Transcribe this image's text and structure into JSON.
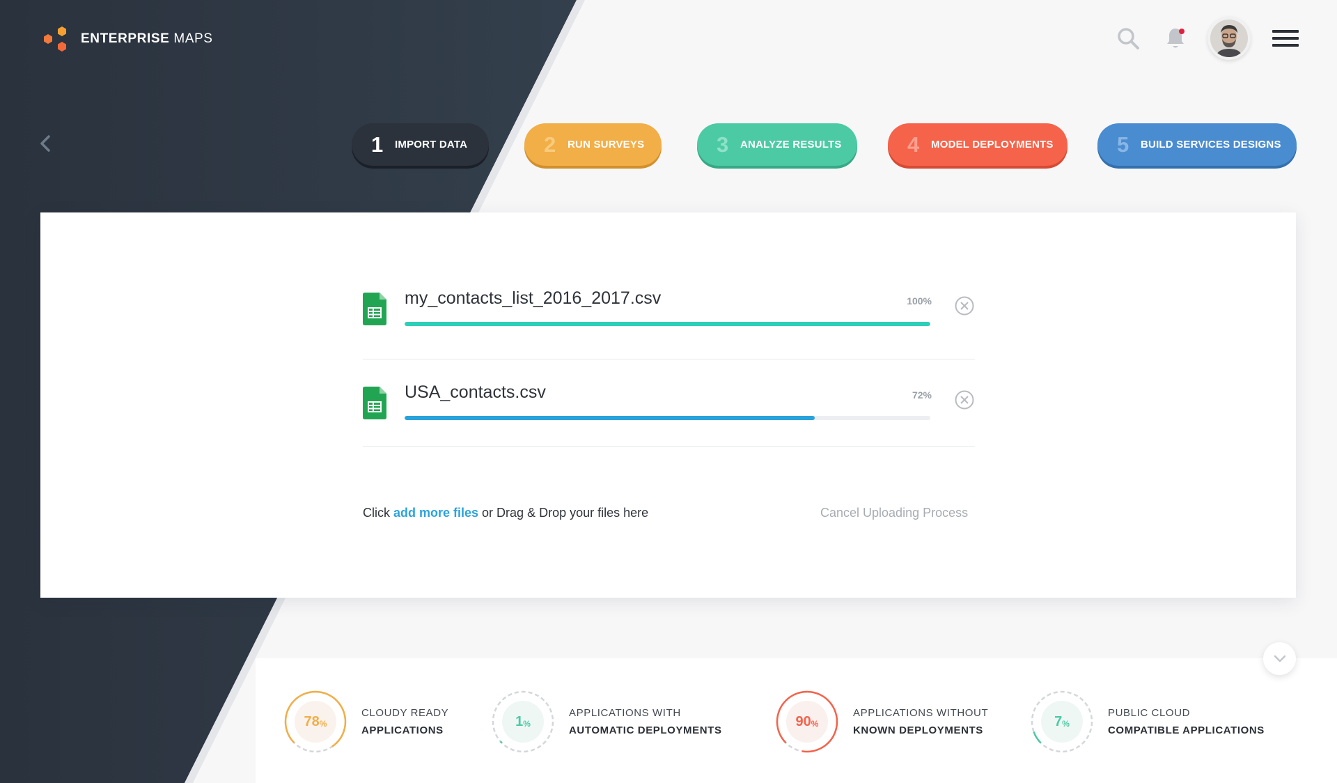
{
  "brand": {
    "name_bold": "ENTERPRISE",
    "name_thin": "MAPS"
  },
  "header": {
    "icons": [
      "search-icon",
      "bell-icon",
      "avatar",
      "menu-icon"
    ],
    "has_notification": true
  },
  "steps": [
    {
      "number": "1",
      "label": "IMPORT DATA",
      "color": "#2b323c"
    },
    {
      "number": "2",
      "label": "RUN SURVEYS",
      "color": "#f2ae47"
    },
    {
      "number": "3",
      "label": "ANALYZE RESULTS",
      "color": "#4ccaa4"
    },
    {
      "number": "4",
      "label": "MODEL DEPLOYMENTS",
      "color": "#f5634a"
    },
    {
      "number": "5",
      "label": "BUILD SERVICES DESIGNS",
      "color": "#4a8cd0"
    }
  ],
  "uploads": [
    {
      "name": "my_contacts_list_2016_2017.csv",
      "progress_label": "100%",
      "progress": 1.0,
      "color": "#2ecfb8"
    },
    {
      "name": "USA_contacts.csv",
      "progress_label": "72%",
      "progress": 0.78,
      "color": "#2aa3dc"
    }
  ],
  "drop_hint": {
    "prefix": "Click ",
    "link": "add more files",
    "suffix": " or Drag & Drop your files here"
  },
  "cancel_label": "Cancel Uploading Process",
  "stats": [
    {
      "value": "78",
      "unit": "%",
      "line1": "CLOUDY READY",
      "line2": "APPLICATIONS",
      "color": "#f2ae47",
      "bg": "#faf2ec",
      "fraction": 0.78
    },
    {
      "value": "1",
      "unit": "%",
      "line1": "APPLICATIONS WITH",
      "line2": "AUTOMATIC DEPLOYMENTS",
      "color": "#4ccaa4",
      "bg": "#eef7f4",
      "fraction": 0.01
    },
    {
      "value": "90",
      "unit": "%",
      "line1": "APPLICATIONS WITHOUT",
      "line2": "KNOWN DEPLOYMENTS",
      "color": "#f5634a",
      "bg": "#faf0ee",
      "fraction": 0.9
    },
    {
      "value": "7",
      "unit": "%",
      "line1": "PUBLIC CLOUD",
      "line2": "COMPATIBLE APPLICATIONS",
      "color": "#4ccaa4",
      "bg": "#eef7f4",
      "fraction": 0.07
    }
  ]
}
